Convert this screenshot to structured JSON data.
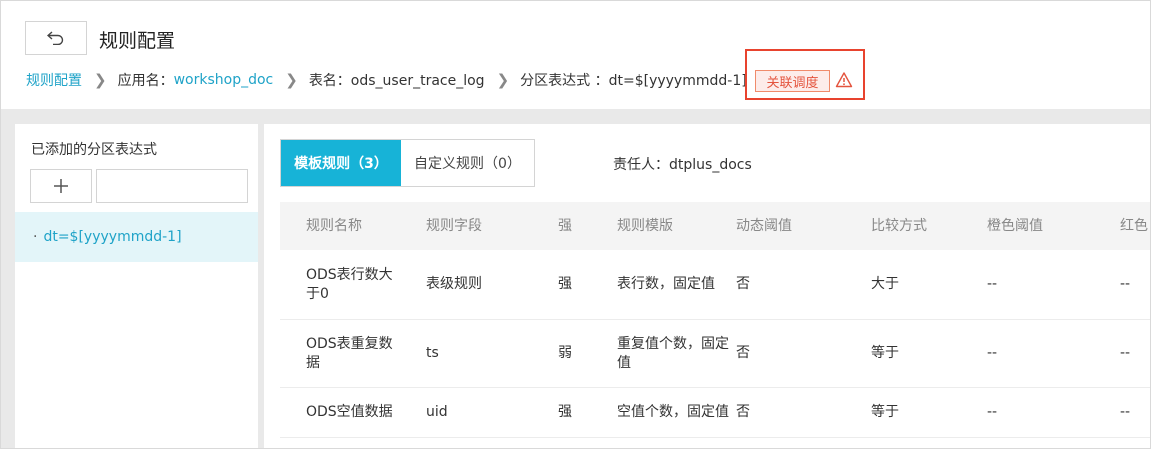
{
  "header": {
    "title": "规则配置",
    "back_icon": "undo-arrow-icon"
  },
  "breadcrumb": {
    "root": "规则配置",
    "app_label": "应用名：",
    "app_value": "workshop_doc",
    "table_label": "表名：ods_user_trace_log",
    "partition_label": "分区表达式 ：dt=$[yyyymmdd-1]",
    "assoc_button": "关联调度",
    "warning_icon": "warning-triangle-icon"
  },
  "colors": {
    "accent": "#17b3d7",
    "link": "#1fa3c8",
    "highlight_border": "#e8432e"
  },
  "left_panel": {
    "title": "已添加的分区表达式",
    "add_icon": "plus",
    "items": [
      {
        "dot": "·",
        "label": "dt=$[yyyymmdd-1]"
      }
    ]
  },
  "right_panel": {
    "tabs": [
      {
        "label": "模板规则（3）",
        "active": true
      },
      {
        "label": "自定义规则（0）",
        "active": false
      }
    ],
    "owner": "责任人：dtplus_docs"
  },
  "table": {
    "headers": [
      "规则名称",
      "规则字段",
      "强",
      "规则模版",
      "动态阈值",
      "比较方式",
      "橙色阈值",
      "红色"
    ],
    "rows": [
      [
        "ODS表行数大于0",
        "表级规则",
        "强",
        "表行数，固定值",
        "否",
        "大于",
        "--",
        "--"
      ],
      [
        "ODS表重复数据",
        "ts",
        "弱",
        "重复值个数，固定值",
        "否",
        "等于",
        "--",
        "--"
      ],
      [
        "ODS空值数据",
        "uid",
        "强",
        "空值个数，固定值",
        "否",
        "等于",
        "--",
        "--"
      ]
    ]
  }
}
